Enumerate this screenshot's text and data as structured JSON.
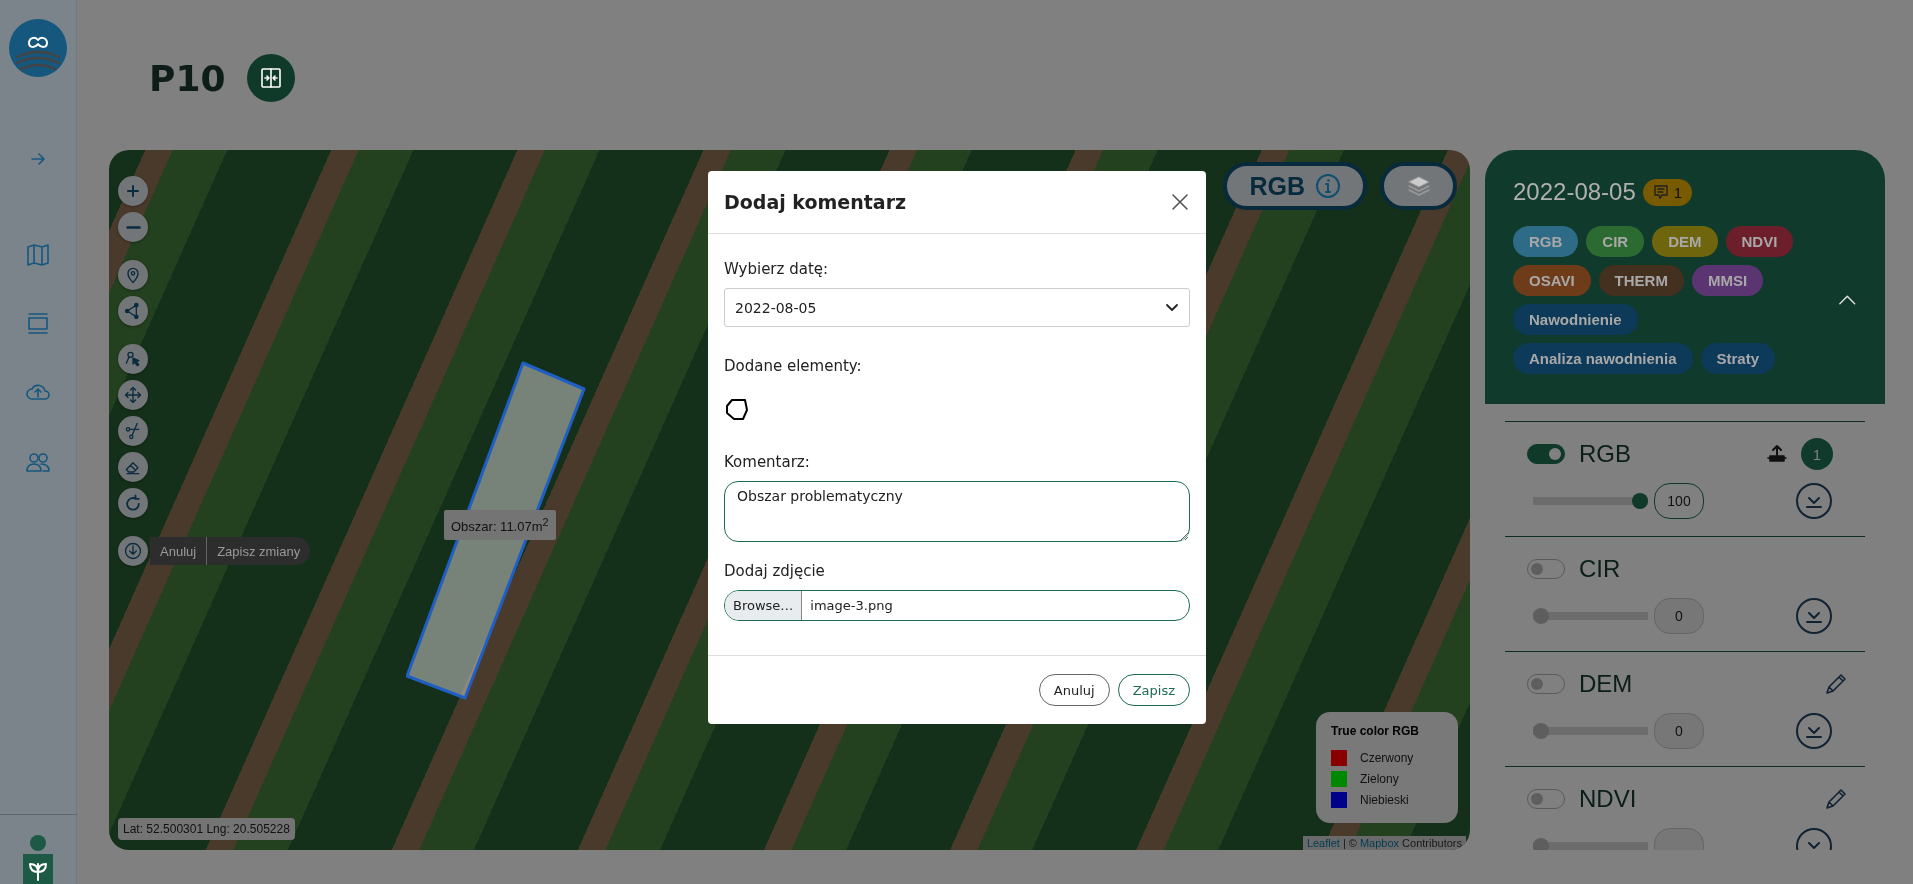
{
  "page": {
    "title": "P10"
  },
  "map": {
    "edit_actions": [
      "Anuluj",
      "Zapisz zmiany"
    ],
    "area_tooltip": "Obszar: 11.07m$^{2}$",
    "coordinates": "Lat: 52.500301 Lng: 20.505228",
    "layer_button": "RGB",
    "legend": {
      "title": "True color RGB",
      "items": [
        {
          "label": "Czerwony",
          "color": "#880000"
        },
        {
          "label": "Zielony",
          "color": "#008800"
        },
        {
          "label": "Niebieski",
          "color": "#000088"
        }
      ]
    },
    "attribution": [
      {
        "text": "Leaflet",
        "link": true
      },
      {
        "text": "| ©",
        "link": false
      },
      {
        "text": "Mapbox",
        "link": true
      },
      {
        "text": "Contributors",
        "link": false
      }
    ]
  },
  "panel": {
    "date": "2022-08-05",
    "comment_count": "1",
    "expanded": true,
    "tags": [
      {
        "label": "RGB",
        "color": "#2e6b86"
      },
      {
        "label": "CIR",
        "color": "#2b6a30"
      },
      {
        "label": "DEM",
        "color": "#6e650c"
      },
      {
        "label": "NDVI",
        "color": "#6c1f2a"
      },
      {
        "label": "OSAVI",
        "color": "#6e3c18"
      },
      {
        "label": "THERM",
        "color": "#44301e"
      },
      {
        "label": "MMSI",
        "color": "#5a3572"
      },
      {
        "label": "Nawodnienie",
        "color": "#0c3a58"
      },
      {
        "label": "Analiza nawodnienia",
        "color": "#0c3a58"
      },
      {
        "label": "Straty",
        "color": "#0c3a58"
      }
    ],
    "layers": [
      {
        "name": "RGB",
        "kind": "commented",
        "on": true,
        "level": 1,
        "value": "100",
        "badge": "1"
      },
      {
        "name": "CIR",
        "kind": "plain",
        "on": false,
        "level": 0,
        "value": "0"
      },
      {
        "name": "DEM",
        "kind": "editable",
        "on": false,
        "level": 0,
        "value": "0"
      },
      {
        "name": "NDVI",
        "kind": "editable",
        "on": false,
        "level": 0
      }
    ]
  },
  "modal": {
    "title": "Dodaj komentarz",
    "date_label": "Wybierz datę:",
    "date_value": "2022-08-05",
    "elements_label": "Dodane elementy:",
    "comment_label": "Komentarz:",
    "comment_value": "Obszar problematyczny",
    "photo_label": "Dodaj zdjęcie",
    "browse_button": "Browse…",
    "file_name": "image-3.png",
    "buttons": [
      {
        "label": "Anuluj",
        "kind": "secondary"
      },
      {
        "label": "Zapisz",
        "kind": "primary"
      }
    ]
  }
}
